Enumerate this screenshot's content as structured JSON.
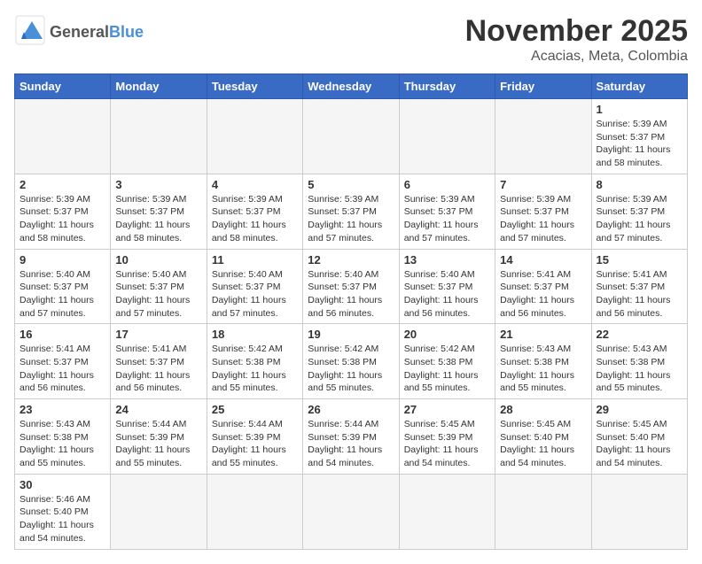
{
  "header": {
    "logo_general": "General",
    "logo_blue": "Blue",
    "month_title": "November 2025",
    "location": "Acacias, Meta, Colombia"
  },
  "weekdays": [
    "Sunday",
    "Monday",
    "Tuesday",
    "Wednesday",
    "Thursday",
    "Friday",
    "Saturday"
  ],
  "weeks": [
    [
      {
        "day": "",
        "empty": true
      },
      {
        "day": "",
        "empty": true
      },
      {
        "day": "",
        "empty": true
      },
      {
        "day": "",
        "empty": true
      },
      {
        "day": "",
        "empty": true
      },
      {
        "day": "",
        "empty": true
      },
      {
        "day": "1",
        "sunrise": "5:39 AM",
        "sunset": "5:37 PM",
        "daylight": "11 hours and 58 minutes."
      }
    ],
    [
      {
        "day": "2",
        "sunrise": "5:39 AM",
        "sunset": "5:37 PM",
        "daylight": "11 hours and 58 minutes."
      },
      {
        "day": "3",
        "sunrise": "5:39 AM",
        "sunset": "5:37 PM",
        "daylight": "11 hours and 58 minutes."
      },
      {
        "day": "4",
        "sunrise": "5:39 AM",
        "sunset": "5:37 PM",
        "daylight": "11 hours and 58 minutes."
      },
      {
        "day": "5",
        "sunrise": "5:39 AM",
        "sunset": "5:37 PM",
        "daylight": "11 hours and 57 minutes."
      },
      {
        "day": "6",
        "sunrise": "5:39 AM",
        "sunset": "5:37 PM",
        "daylight": "11 hours and 57 minutes."
      },
      {
        "day": "7",
        "sunrise": "5:39 AM",
        "sunset": "5:37 PM",
        "daylight": "11 hours and 57 minutes."
      },
      {
        "day": "8",
        "sunrise": "5:39 AM",
        "sunset": "5:37 PM",
        "daylight": "11 hours and 57 minutes."
      }
    ],
    [
      {
        "day": "9",
        "sunrise": "5:40 AM",
        "sunset": "5:37 PM",
        "daylight": "11 hours and 57 minutes."
      },
      {
        "day": "10",
        "sunrise": "5:40 AM",
        "sunset": "5:37 PM",
        "daylight": "11 hours and 57 minutes."
      },
      {
        "day": "11",
        "sunrise": "5:40 AM",
        "sunset": "5:37 PM",
        "daylight": "11 hours and 57 minutes."
      },
      {
        "day": "12",
        "sunrise": "5:40 AM",
        "sunset": "5:37 PM",
        "daylight": "11 hours and 56 minutes."
      },
      {
        "day": "13",
        "sunrise": "5:40 AM",
        "sunset": "5:37 PM",
        "daylight": "11 hours and 56 minutes."
      },
      {
        "day": "14",
        "sunrise": "5:41 AM",
        "sunset": "5:37 PM",
        "daylight": "11 hours and 56 minutes."
      },
      {
        "day": "15",
        "sunrise": "5:41 AM",
        "sunset": "5:37 PM",
        "daylight": "11 hours and 56 minutes."
      }
    ],
    [
      {
        "day": "16",
        "sunrise": "5:41 AM",
        "sunset": "5:37 PM",
        "daylight": "11 hours and 56 minutes."
      },
      {
        "day": "17",
        "sunrise": "5:41 AM",
        "sunset": "5:37 PM",
        "daylight": "11 hours and 56 minutes."
      },
      {
        "day": "18",
        "sunrise": "5:42 AM",
        "sunset": "5:38 PM",
        "daylight": "11 hours and 55 minutes."
      },
      {
        "day": "19",
        "sunrise": "5:42 AM",
        "sunset": "5:38 PM",
        "daylight": "11 hours and 55 minutes."
      },
      {
        "day": "20",
        "sunrise": "5:42 AM",
        "sunset": "5:38 PM",
        "daylight": "11 hours and 55 minutes."
      },
      {
        "day": "21",
        "sunrise": "5:43 AM",
        "sunset": "5:38 PM",
        "daylight": "11 hours and 55 minutes."
      },
      {
        "day": "22",
        "sunrise": "5:43 AM",
        "sunset": "5:38 PM",
        "daylight": "11 hours and 55 minutes."
      }
    ],
    [
      {
        "day": "23",
        "sunrise": "5:43 AM",
        "sunset": "5:38 PM",
        "daylight": "11 hours and 55 minutes."
      },
      {
        "day": "24",
        "sunrise": "5:44 AM",
        "sunset": "5:39 PM",
        "daylight": "11 hours and 55 minutes."
      },
      {
        "day": "25",
        "sunrise": "5:44 AM",
        "sunset": "5:39 PM",
        "daylight": "11 hours and 55 minutes."
      },
      {
        "day": "26",
        "sunrise": "5:44 AM",
        "sunset": "5:39 PM",
        "daylight": "11 hours and 54 minutes."
      },
      {
        "day": "27",
        "sunrise": "5:45 AM",
        "sunset": "5:39 PM",
        "daylight": "11 hours and 54 minutes."
      },
      {
        "day": "28",
        "sunrise": "5:45 AM",
        "sunset": "5:40 PM",
        "daylight": "11 hours and 54 minutes."
      },
      {
        "day": "29",
        "sunrise": "5:45 AM",
        "sunset": "5:40 PM",
        "daylight": "11 hours and 54 minutes."
      }
    ],
    [
      {
        "day": "30",
        "sunrise": "5:46 AM",
        "sunset": "5:40 PM",
        "daylight": "11 hours and 54 minutes."
      },
      {
        "day": "",
        "empty": true
      },
      {
        "day": "",
        "empty": true
      },
      {
        "day": "",
        "empty": true
      },
      {
        "day": "",
        "empty": true
      },
      {
        "day": "",
        "empty": true
      },
      {
        "day": "",
        "empty": true
      }
    ]
  ]
}
